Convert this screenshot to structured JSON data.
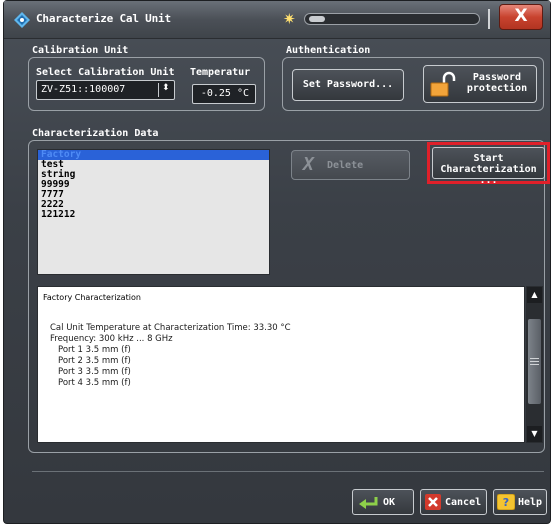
{
  "window": {
    "title": "Characterize Cal Unit",
    "close_label": "X"
  },
  "calibration_unit": {
    "group_label": "Calibration Unit",
    "select_label": "Select Calibration Unit",
    "selected_unit": "ZV-Z51::100007",
    "temperature_label": "Temperatur",
    "temperature_value": "-0.25 °C"
  },
  "authentication": {
    "group_label": "Authentication",
    "set_password_label": "Set Password...",
    "password_protection_line1": "Password",
    "password_protection_line2": "protection"
  },
  "characterization": {
    "group_label": "Characterization Data",
    "items": [
      {
        "label": "Factory",
        "selected": true
      },
      {
        "label": "test"
      },
      {
        "label": "string"
      },
      {
        "label": "99999"
      },
      {
        "label": "7777"
      },
      {
        "label": "2222"
      },
      {
        "label": "121212"
      }
    ],
    "delete_label": "Delete",
    "start_line1": "Start",
    "start_line2": "Characterization ..."
  },
  "details": {
    "title": "Factory Characterization",
    "lines": [
      "Cal Unit Temperature at Characterization Time: 33.30 °C",
      "Frequency: 300 kHz ... 8 GHz",
      "Port 1 3.5 mm (f)",
      "Port 2 3.5 mm (f)",
      "Port 3 3.5 mm (f)",
      "Port 4 3.5 mm (f)"
    ]
  },
  "footer": {
    "ok_label": "OK",
    "cancel_label": "Cancel",
    "help_label": "Help"
  },
  "colors": {
    "accent_red": "#e0202a",
    "selection_blue": "#2a62d8"
  }
}
